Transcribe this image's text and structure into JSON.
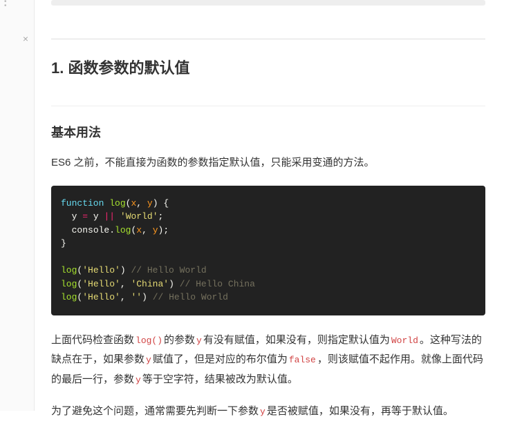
{
  "section": {
    "title": "1. 函数参数的默认值",
    "subsection_title": "基本用法",
    "intro_paragraph": "ES6 之前，不能直接为函数的参数指定默认值，只能采用变通的方法。"
  },
  "code1": {
    "kw_function": "function",
    "fn_log": "log",
    "p_x": "x",
    "p_y": "y",
    "str_world": "'World'",
    "id_console": "console",
    "m_log": "log",
    "str_hello": "'Hello'",
    "str_china": "'China'",
    "str_empty": "''",
    "op_or": "||",
    "op_eq": "=",
    "cm_hw": "// Hello World",
    "cm_hc": "// Hello China",
    "cm_hw2": "// Hello World",
    "punct_lbrace": "{",
    "punct_rbrace": "}",
    "punct_semi": ";",
    "punct_comma": ",",
    "punct_lparen": "(",
    "punct_rparen": ")",
    "punct_dot": "."
  },
  "para1": {
    "t1": "上面代码检查函数",
    "c1": "log()",
    "t2": "的参数",
    "c2": "y",
    "t3": "有没有赋值，如果没有，则指定默认值为",
    "c3": "World",
    "t4": "。这种写法的缺点在于，如果参数",
    "c4": "y",
    "t5": "赋值了，但是对应的布尔值为",
    "c5": "false",
    "t6": "，则该赋值不起作用。就像上面代码的最后一行，参数",
    "c6": "y",
    "t7": "等于空字符，结果被改为默认值。"
  },
  "para2": {
    "t1": "为了避免这个问题，通常需要先判断一下参数",
    "c1": "y",
    "t2": "是否被赋值，如果没有，再等于默认值。"
  }
}
